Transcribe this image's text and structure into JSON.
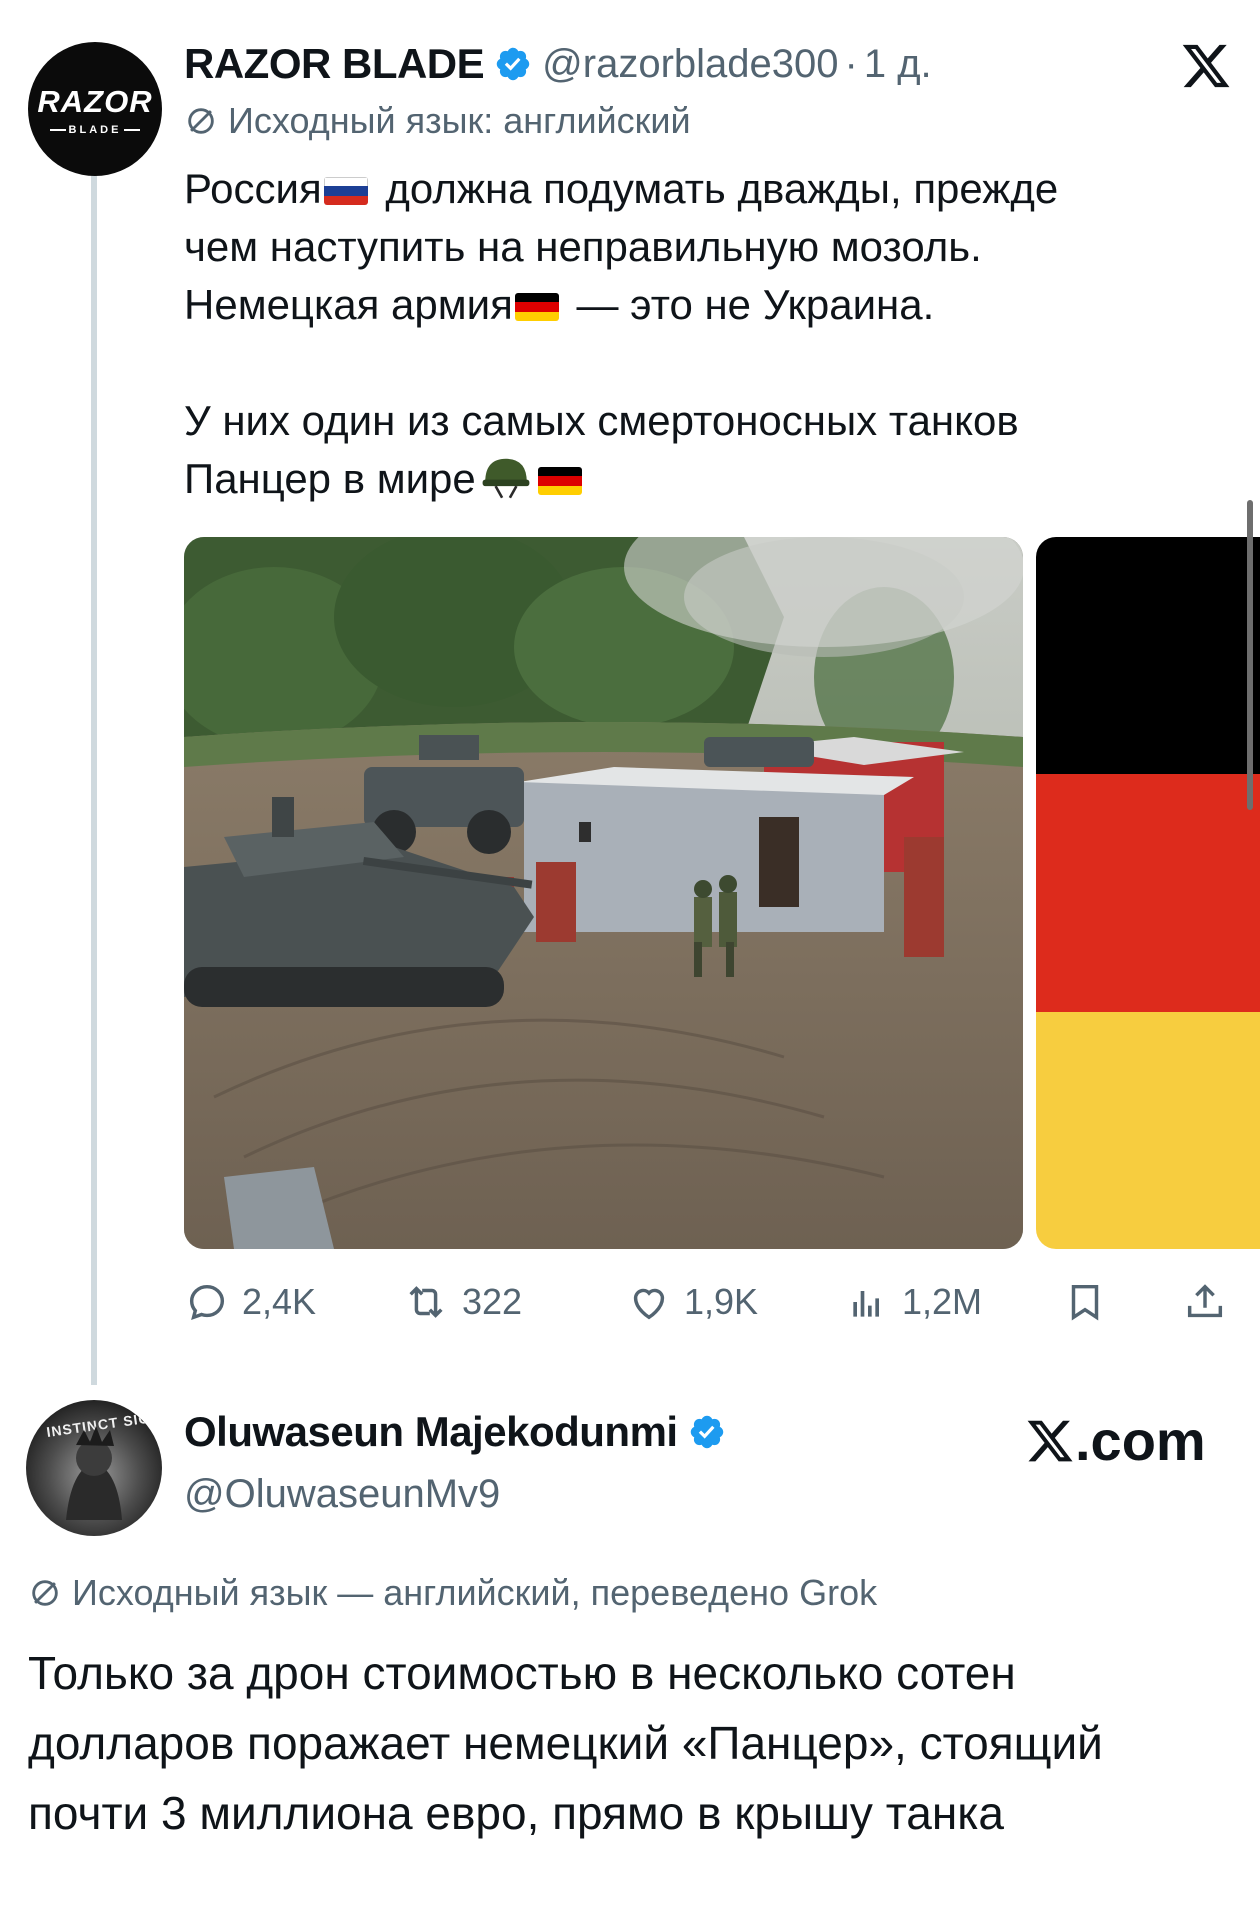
{
  "tweet": {
    "author_name": "RAZOR BLADE",
    "handle": "@razorblade300",
    "separator": "·",
    "time": "1 д.",
    "avatar_text": "RAZOR",
    "avatar_subtext": "BLADE",
    "translate_note": "Исходный язык: английский",
    "lines": {
      "l1a": "Россия",
      "l1b": " должна подумать дважды, прежде",
      "l2": "чем наступить на неправильную мозоль.",
      "l3a": "Немецкая армия",
      "l3b": " — это не Украина.",
      "l4": "У них один из самых смертоносных танков",
      "l5": "Панцер в мире"
    },
    "flags": {
      "russia": [
        "#ffffff",
        "#1c3f95",
        "#d52b1e"
      ],
      "germany": [
        "#000000",
        "#dd0000",
        "#ffce00"
      ]
    },
    "actions": {
      "replies": "2,4K",
      "reposts": "322",
      "likes": "1,9K",
      "views": "1,2M"
    },
    "icons": [
      "reply-icon",
      "repost-icon",
      "like-icon",
      "views-icon",
      "bookmark-icon",
      "share-icon",
      "x-logo-icon",
      "verified-badge-icon",
      "translate-icon",
      "helmet-icon"
    ]
  },
  "reply": {
    "author_name": "Oluwaseun Majekodunmi",
    "handle": "@OluwaseunMv9",
    "avatar_text": "INSTINCT SIGN",
    "brand": ".com",
    "translate_note": "Исходный язык — английский, переведено Grok",
    "text": "Только за дрон стоимостью в несколько сотен долларов поражает немецкий «Панцер», стоящий почти 3 миллиона евро, прямо в крышу танка"
  },
  "colors": {
    "text_primary": "#0f1419",
    "text_secondary": "#536471",
    "verified_blue": "#1d9bf0",
    "thread_line": "#cfd9de",
    "german_black": "#000000",
    "german_red": "#dd0000",
    "german_gold": "#f7cd3f"
  }
}
